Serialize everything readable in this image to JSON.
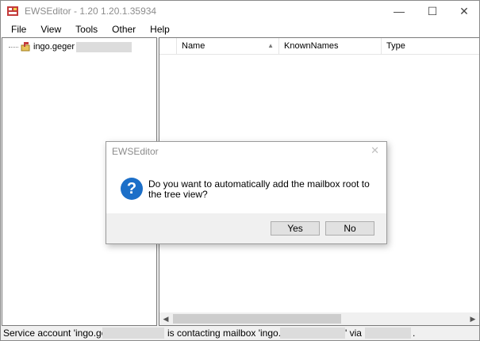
{
  "window": {
    "title": "EWSEditor - 1.20 1.20.1.35934",
    "minimize_glyph": "—",
    "maximize_glyph": "☐",
    "close_glyph": "✕"
  },
  "menu": [
    "File",
    "View",
    "Tools",
    "Other",
    "Help"
  ],
  "tree": {
    "root_label": "ingo.geger"
  },
  "list": {
    "columns": [
      "Name",
      "KnownNames",
      "Type"
    ]
  },
  "status": {
    "part1": "Service account 'ingo.gege",
    "part2": "is contacting mailbox 'ingo.geg",
    "part3": "' via",
    "part4": "."
  },
  "dialog": {
    "title": "EWSEditor",
    "message": "Do you want to automatically add the mailbox root to the tree view?",
    "yes_label": "Yes",
    "no_label": "No",
    "icon": "question-icon"
  },
  "colors": {
    "question_icon": "#1c6fc8",
    "redaction": "#dcdcdc"
  }
}
